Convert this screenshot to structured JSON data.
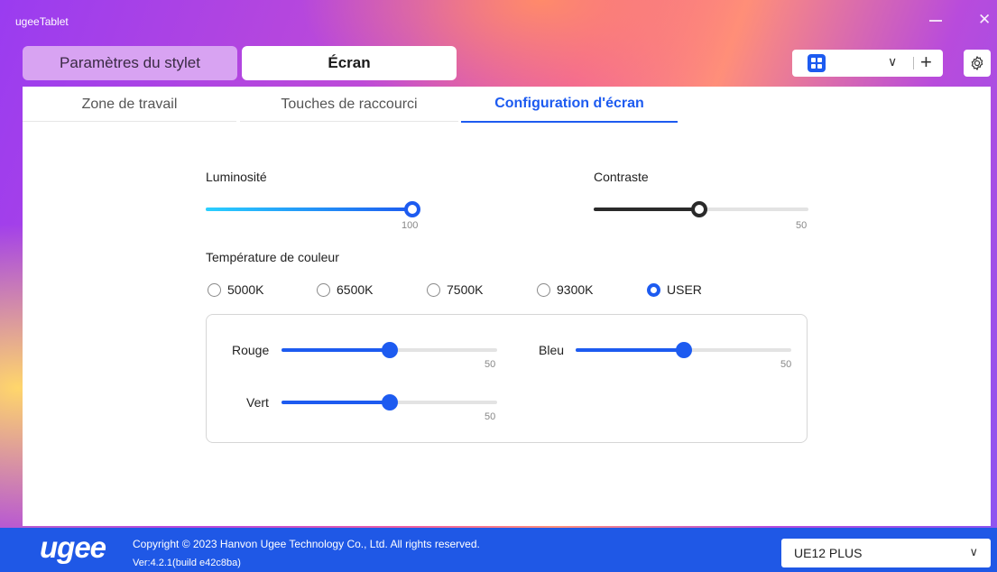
{
  "window": {
    "title": "ugeeTablet",
    "close_symbol": "✕"
  },
  "top_tabs": [
    {
      "label": "Paramètres du stylet",
      "active": false
    },
    {
      "label": "Écran",
      "active": true
    }
  ],
  "device_selector": {
    "chevron": "∨",
    "add_symbol": "+"
  },
  "sub_tabs": [
    {
      "label": "Zone de travail",
      "active": false
    },
    {
      "label": "Touches de raccourci",
      "active": false
    },
    {
      "label": "Configuration d'écran",
      "active": true
    }
  ],
  "brightness": {
    "label": "Luminosité",
    "value": 100,
    "max": 100
  },
  "contrast": {
    "label": "Contraste",
    "value": 50,
    "max": 100
  },
  "color_temperature": {
    "label": "Température de couleur",
    "options": [
      "5000K",
      "6500K",
      "7500K",
      "9300K",
      "USER"
    ],
    "selected": "USER"
  },
  "user_rgb": {
    "red": {
      "label": "Rouge",
      "value": 50,
      "max": 100
    },
    "green": {
      "label": "Vert",
      "value": 50,
      "max": 100
    },
    "blue": {
      "label": "Bleu",
      "value": 50,
      "max": 100
    }
  },
  "footer": {
    "logo": "ugee",
    "copyright": "Copyright © 2023 Hanvon Ugee Technology Co., Ltd. All rights reserved.",
    "version": "Ver:4.2.1(build e42c8ba)",
    "model": "UE12 PLUS",
    "model_chevron": "∨"
  },
  "colors": {
    "accent": "#1d5bf0",
    "footer_bg": "#1f58e6",
    "pen_tab_bg": "#d8a3f2",
    "contrast_knob": "#2a2a2a"
  }
}
